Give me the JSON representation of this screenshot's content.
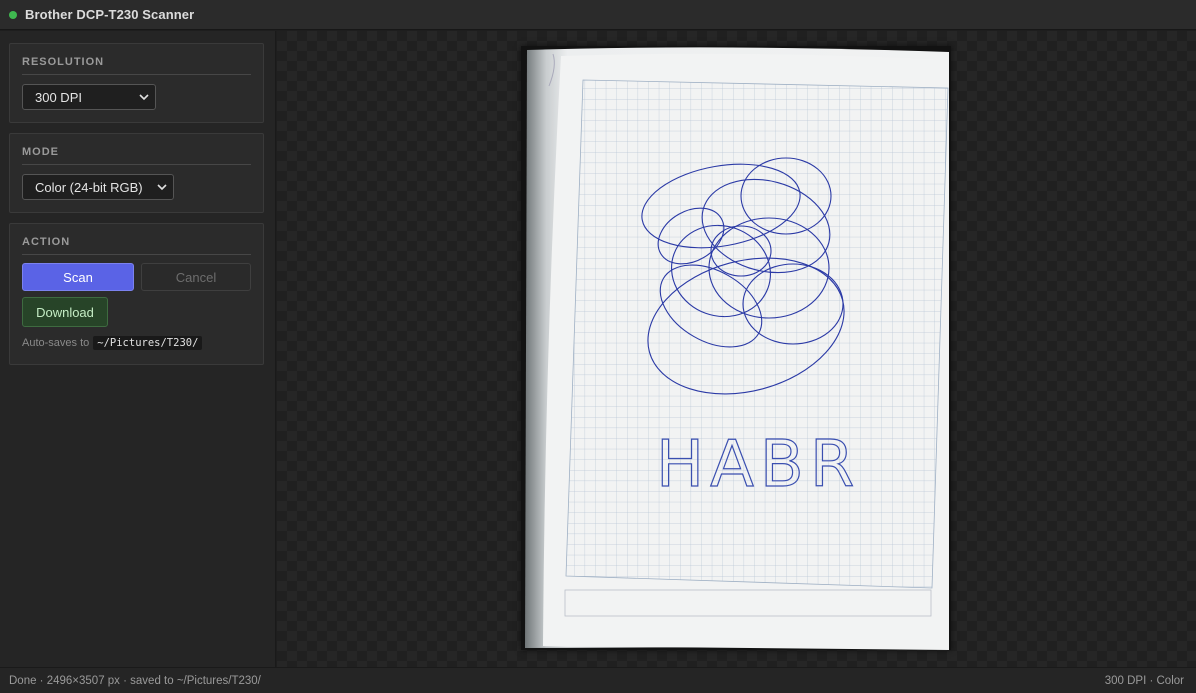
{
  "app": {
    "title": "Brother DCP-T230 Scanner",
    "status_color": "#3fb950"
  },
  "sidebar": {
    "resolution": {
      "title": "RESOLUTION",
      "selected": "300 DPI"
    },
    "mode": {
      "title": "MODE",
      "selected": "Color (24-bit RGB)"
    },
    "action": {
      "title": "ACTION",
      "scan_label": "Scan",
      "cancel_label": "Cancel",
      "download_label": "Download",
      "autosave_prefix": "Auto-saves to",
      "autosave_path": "~/Pictures/T230/"
    }
  },
  "preview": {
    "handwriting": "HABR"
  },
  "statusbar": {
    "left": "Done · 2496×3507 px · saved to ~/Pictures/T230/",
    "right": "300 DPI · Color"
  },
  "colors": {
    "accent": "#5a63e6",
    "download_bg": "#274428",
    "ink": "#2b3aa6"
  },
  "icons": {
    "select_arrow": "chevron-down-icon",
    "status": "status-dot-icon"
  }
}
